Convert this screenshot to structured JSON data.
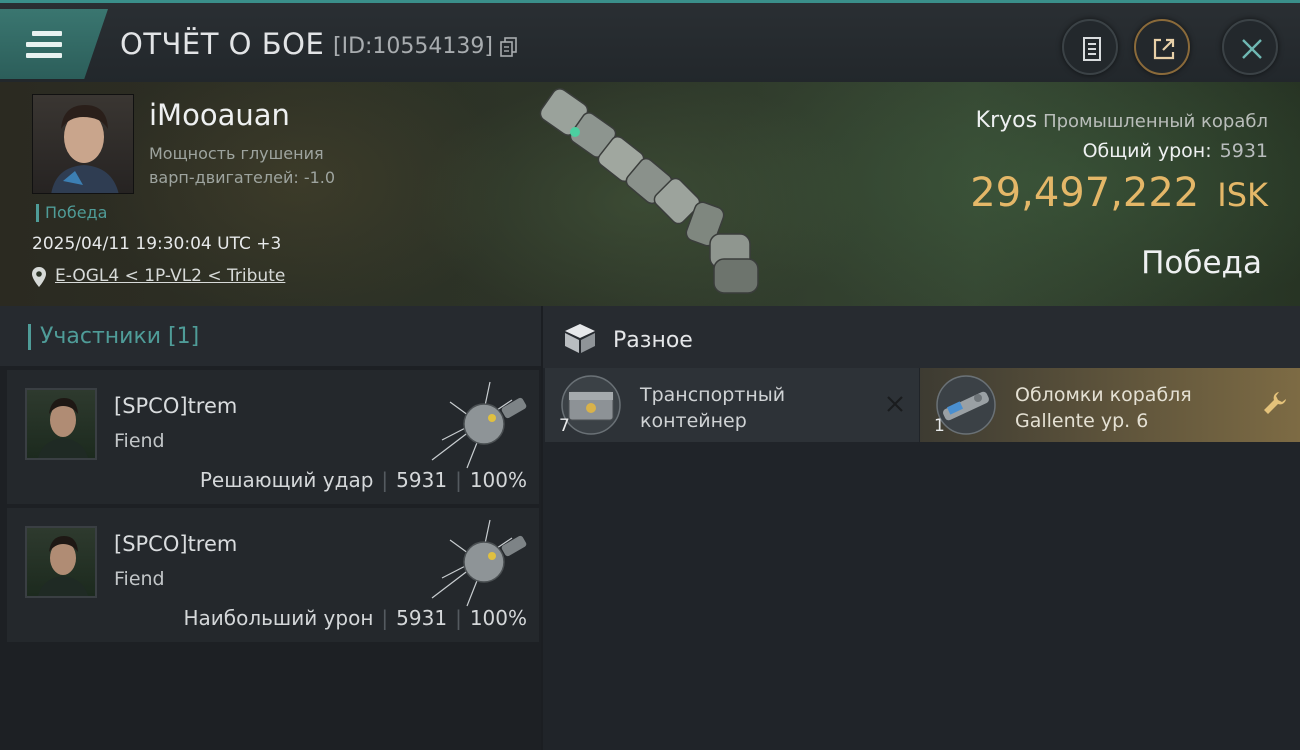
{
  "header": {
    "title": "ОТЧЁТ О БОЕ",
    "report_id": "[ID:10554139]"
  },
  "victim": {
    "name": "iMooauan",
    "stat_line1": "Мощность глушения",
    "stat_line2": "варп-двигателей: -1.0",
    "status_tag": "Победа",
    "datetime": "2025/04/11 19:30:04 UTC +3",
    "location": "E-OGL4 < 1P-VL2 < Tribute"
  },
  "ship": {
    "name": "Kryos",
    "class": "Промышленный корабл",
    "total_damage_label": "Общий урон:",
    "total_damage_value": "5931",
    "isk_value": "29,497,222",
    "isk_unit": "ISK",
    "result": "Победа"
  },
  "participants": {
    "header": "Участники [1]",
    "items": [
      {
        "name": "[SPCO]trem",
        "ship": "Fiend",
        "role": "Решающий удар",
        "damage": "5931",
        "percent": "100%"
      },
      {
        "name": "[SPCO]trem",
        "ship": "Fiend",
        "role": "Наибольший урон",
        "damage": "5931",
        "percent": "100%"
      }
    ]
  },
  "misc": {
    "header": "Разное",
    "items": [
      {
        "qty": "7",
        "line1": "Транспортный",
        "line2": "контейнер",
        "action_icon": "close-icon"
      },
      {
        "qty": "1",
        "line1": "Обломки корабля",
        "line2": "Gallente ур. 6",
        "action_icon": "wrench-icon"
      }
    ]
  },
  "colors": {
    "accent_teal": "#4f9c98",
    "isk_gold": "#e4b768",
    "dropped_item_gold": "#7d6b44"
  }
}
